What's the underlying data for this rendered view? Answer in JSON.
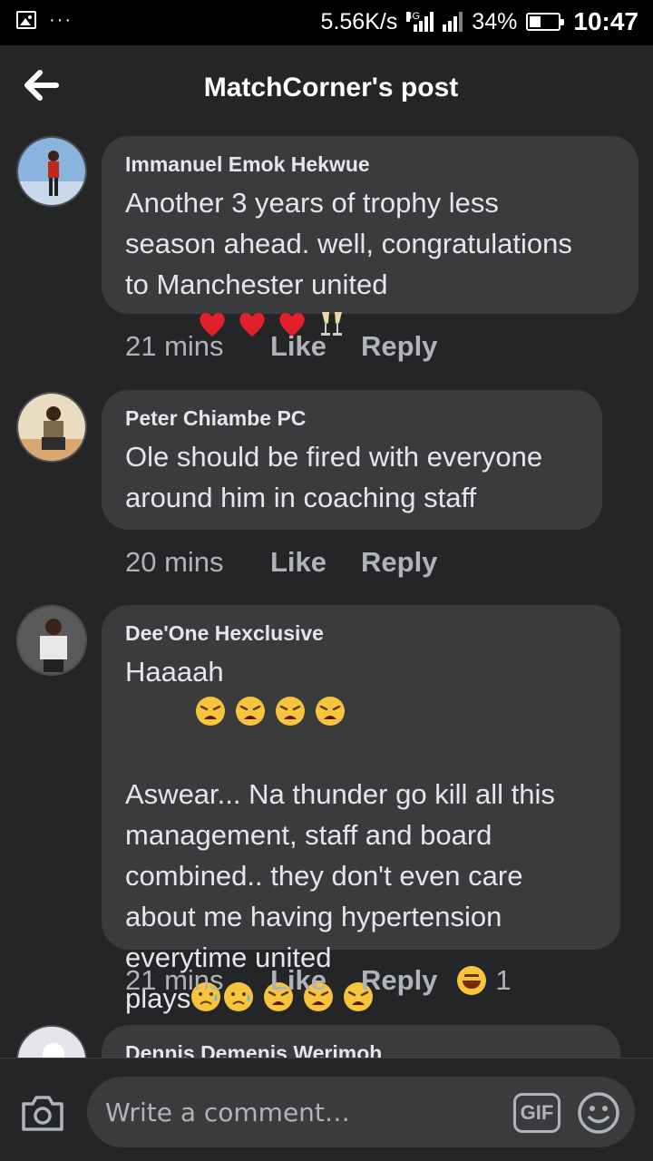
{
  "status_bar": {
    "net_speed": "5.56K/s",
    "net_type": "4G",
    "sim1": "1",
    "sim2": "2",
    "battery": "34%",
    "battery_level": 0.34,
    "time": "10:47"
  },
  "header": {
    "title": "MatchCorner's post",
    "back_icon": "arrow-left-icon"
  },
  "comments": [
    {
      "author": "Immanuel Emok Hekwue",
      "text": "Another 3 years of trophy less\nseason ahead. well, congratulations\nto Manchester united",
      "emojis": [
        "red-heart-icon",
        "red-heart-icon",
        "red-heart-icon",
        "champagne-glasses-icon"
      ],
      "time": "21 mins",
      "like": "Like",
      "reply": "Reply"
    },
    {
      "author": "Peter Chiambe PC",
      "text": "Ole should be fired with everyone\naround him in coaching staff",
      "time": "20 mins",
      "like": "Like",
      "reply": "Reply"
    },
    {
      "author": "Dee'One Hexclusive",
      "line1": "Haaaah",
      "line1_emojis": [
        "weary-face-icon",
        "weary-face-icon",
        "weary-face-icon",
        "weary-face-icon"
      ],
      "text": "Aswear... Na thunder go kill all this\nmanagement, staff and board\ncombined.. they don't even care\nabout me having hypertension\neverytime united",
      "last_word": "plays",
      "last_emojis": [
        "sad-sweat-face-icon",
        "sad-sweat-face-icon",
        "weary-face-icon",
        "weary-face-icon",
        "weary-face-icon"
      ],
      "time": "21 mins",
      "like": "Like",
      "reply": "Reply",
      "reaction_count": "1",
      "reaction_icon": "laughing-face-icon"
    },
    {
      "author": "Dennis Demenis Werimoh"
    }
  ],
  "composer": {
    "placeholder": "Write a comment…",
    "gif_label": "GIF",
    "camera_icon": "camera-icon",
    "emoji_icon": "smiley-icon"
  },
  "colors": {
    "background": "#242526",
    "bubble": "#3a3b3c",
    "text": "#e4e6eb",
    "secondary_text": "#b0b3b8",
    "heart": "#e0202a",
    "emoji_yellow": "#f7c43b"
  }
}
